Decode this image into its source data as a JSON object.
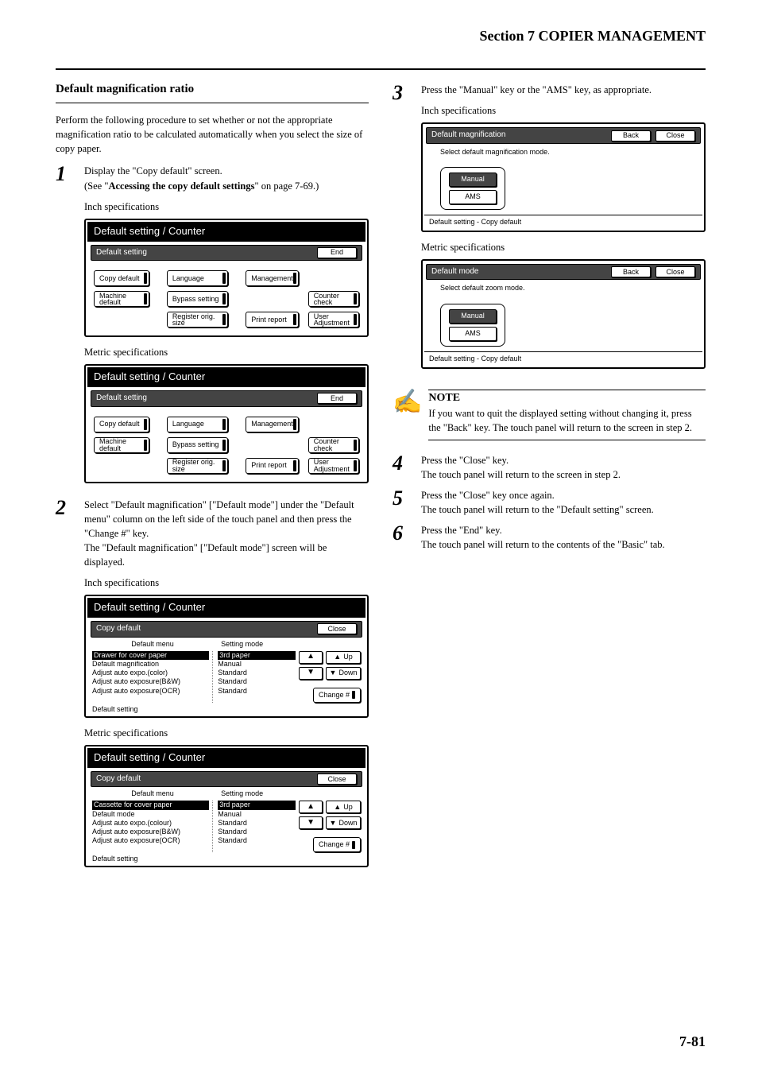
{
  "header": {
    "section_title": "Section 7  COPIER MANAGEMENT"
  },
  "page_number": "7-81",
  "left": {
    "subheading": "Default magnification ratio",
    "intro": "Perform the following procedure to set whether or not the appropriate magnification ratio to be calculated automatically when you select the size of copy paper.",
    "step1_line1": "Display the \"Copy default\" screen.",
    "step1_line2a": "(See \"",
    "step1_strong": "Accessing the copy default settings",
    "step1_line2b": "\" on page 7-69.)",
    "spec_inch": "Inch specifications",
    "spec_metric": "Metric specifications",
    "panel_main_title": "Default setting / Counter",
    "panel_strip_default_setting": "Default setting",
    "panel_strip_end": "End",
    "panel_strip_close": "Close",
    "panel_strip_back": "Back",
    "btn_copy_default": "Copy default",
    "btn_machine_default": "Machine default",
    "btn_language": "Language",
    "btn_bypass_setting": "Bypass setting",
    "btn_register_orig": "Register orig. size",
    "btn_management": "Management",
    "btn_print_report": "Print report",
    "btn_counter_check": "Counter check",
    "btn_user_adjust": "User Adjustment",
    "strip_copy_default_label": "Copy default",
    "col_default_menu": "Default menu",
    "col_setting_mode": "Setting mode",
    "menu_items_inch": [
      "Drawer for cover paper",
      "Default magnification",
      "Adjust auto expo.(color)",
      "Adjust auto exposure(B&W)",
      "Adjust auto exposure(OCR)"
    ],
    "mode_items": [
      "3rd paper",
      "Manual",
      "Standard",
      "Standard",
      "Standard"
    ],
    "menu_items_metric": [
      "Cassette for cover paper",
      "Default mode",
      "Adjust auto expo.(colour)",
      "Adjust auto exposure(B&W)",
      "Adjust auto exposure(OCR)"
    ],
    "btn_up": "Up",
    "btn_down": "Down",
    "btn_change": "Change #",
    "tab_default_setting": "Default setting",
    "step2": "Select \"Default magnification\" [\"Default mode\"] under the \"Default menu\" column on the left side of the touch panel and then press the \"Change #\" key.",
    "step2b": "The \"Default magnification\" [\"Default mode\"] screen will be displayed."
  },
  "right": {
    "step3_line1": "Press the \"Manual\" key or the \"AMS\" key, as appropriate.",
    "spec_inch": "Inch specifications",
    "spec_metric": "Metric specifications",
    "panel_strip_default_mag": "Default magnification",
    "panel_strip_default_mode": "Default mode",
    "panel_instruction_inch": "Select default magnification mode.",
    "panel_instruction_metric": "Select default zoom mode.",
    "opt_manual": "Manual",
    "opt_ams": "AMS",
    "footer_text": "Default setting - Copy default",
    "note_title": "NOTE",
    "note_text": "If you want to quit the displayed setting without changing it, press the \"Back\" key. The touch panel will return to the screen in step 2.",
    "step4": "Press the \"Close\" key.",
    "step4b": "The touch panel will return to the screen in step 2.",
    "step5": "Press the \"Close\" key once again.",
    "step5b": "The touch panel will return to the \"Default setting\" screen.",
    "step6": "Press the \"End\" key.",
    "step6b": "The touch panel will return to the contents of the \"Basic\" tab."
  }
}
